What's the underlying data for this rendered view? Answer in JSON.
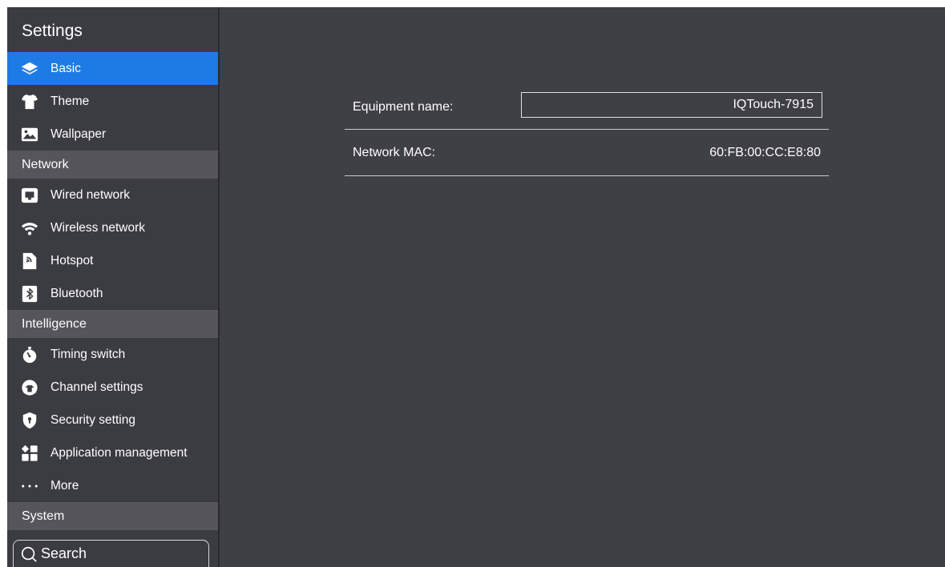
{
  "sidebar": {
    "title": "Settings",
    "items": [
      {
        "type": "item",
        "label": "Basic",
        "icon": "layers-icon",
        "active": true
      },
      {
        "type": "item",
        "label": "Theme",
        "icon": "shirt-icon"
      },
      {
        "type": "item",
        "label": "Wallpaper",
        "icon": "image-icon"
      },
      {
        "type": "section",
        "label": "Network"
      },
      {
        "type": "item",
        "label": "Wired network",
        "icon": "ethernet-icon"
      },
      {
        "type": "item",
        "label": "Wireless network",
        "icon": "wifi-icon"
      },
      {
        "type": "item",
        "label": "Hotspot",
        "icon": "hotspot-icon"
      },
      {
        "type": "item",
        "label": "Bluetooth",
        "icon": "bluetooth-icon"
      },
      {
        "type": "section",
        "label": "Intelligence"
      },
      {
        "type": "item",
        "label": "Timing switch",
        "icon": "stopwatch-icon"
      },
      {
        "type": "item",
        "label": "Channel settings",
        "icon": "channel-icon"
      },
      {
        "type": "item",
        "label": "Security setting",
        "icon": "shield-icon"
      },
      {
        "type": "item",
        "label": "Application management",
        "icon": "apps-icon"
      },
      {
        "type": "item",
        "label": "More",
        "icon": "more-icon"
      },
      {
        "type": "section",
        "label": "System"
      }
    ],
    "search": {
      "label": "Search",
      "icon": "search-icon"
    }
  },
  "main": {
    "equipment_name_label": "Equipment name:",
    "equipment_name_value": "IQTouch-7915",
    "mac_label": "Network MAC:",
    "mac_value": "60:FB:00:CC:E8:80"
  },
  "colors": {
    "active": "#1e7be6",
    "background": "#3f3f46",
    "sidebar": "#3b3b42",
    "section": "#55555b"
  }
}
